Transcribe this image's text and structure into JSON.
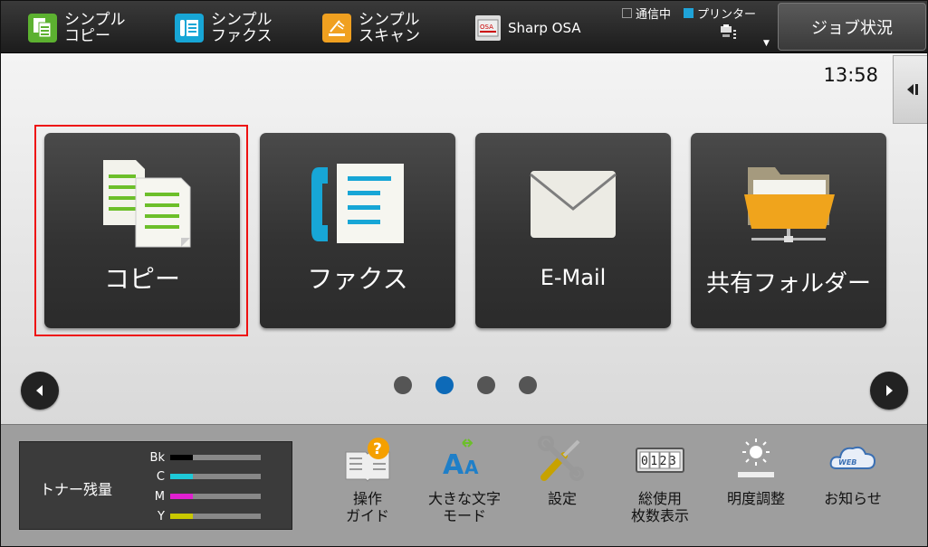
{
  "topbar": {
    "shortcuts": [
      {
        "label": "シンプル\nコピー",
        "icon": "simple-copy-icon"
      },
      {
        "label": "シンプル\nファクス",
        "icon": "simple-fax-icon"
      },
      {
        "label": "シンプル\nスキャン",
        "icon": "simple-scan-icon"
      },
      {
        "label": "Sharp OSA",
        "icon": "sharp-osa-icon"
      }
    ],
    "status": {
      "communicating": "通信中",
      "printer": "プリンター"
    },
    "job_status": "ジョブ状況"
  },
  "main": {
    "clock": "13:58",
    "tiles": [
      {
        "label": "コピー",
        "icon": "copy-icon"
      },
      {
        "label": "ファクス",
        "icon": "fax-icon"
      },
      {
        "label": "E-Mail",
        "icon": "email-icon"
      },
      {
        "label": "共有フォルダー",
        "icon": "shared-folder-icon"
      }
    ],
    "page_count": 4,
    "current_page": 2
  },
  "bottom": {
    "toner": {
      "title": "トナー残量",
      "levels": [
        {
          "label": "Bk",
          "color": "#000000",
          "level": 0.25
        },
        {
          "label": "C",
          "color": "#1ec9d8",
          "level": 0.25
        },
        {
          "label": "M",
          "color": "#e020d0",
          "level": 0.25
        },
        {
          "label": "Y",
          "color": "#c8c800",
          "level": 0.25
        }
      ]
    },
    "buttons": [
      {
        "label": "操作\nガイド",
        "icon": "operation-guide-icon"
      },
      {
        "label": "大きな文字\nモード",
        "icon": "large-text-mode-icon"
      },
      {
        "label": "設定",
        "icon": "settings-icon"
      },
      {
        "label": "総使用\n枚数表示",
        "icon": "total-count-icon",
        "counter": "0123"
      },
      {
        "label": "明度調整",
        "icon": "brightness-icon"
      },
      {
        "label": "お知らせ",
        "icon": "notification-icon",
        "badge": "WEB"
      }
    ]
  },
  "colors": {
    "selection": "#ee1111",
    "active_dot": "#0d6ab8",
    "copy_green": "#6cbf2a",
    "fax_cyan": "#17a6d6",
    "scan_orange": "#f0a020"
  }
}
